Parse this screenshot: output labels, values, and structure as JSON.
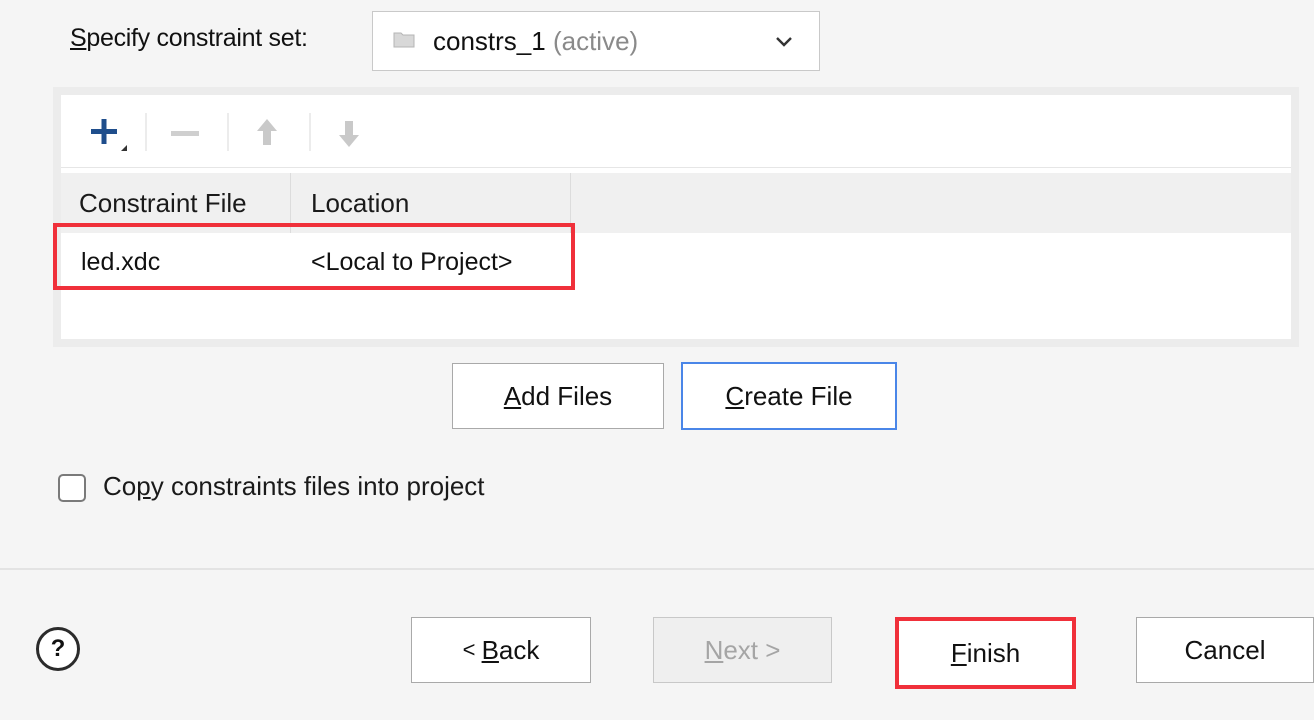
{
  "constraint_set": {
    "label": "Specify constraint set:",
    "label_mnemonic": "S",
    "label_rest": "pecify constraint set:",
    "value_name": "constrs_1",
    "value_status": "(active)"
  },
  "toolbar": {
    "add_icon": "plus-icon",
    "remove_icon": "minus-icon",
    "move_up_icon": "arrow-up-icon",
    "move_down_icon": "arrow-down-icon"
  },
  "table": {
    "columns": [
      "Constraint File",
      "Location"
    ],
    "rows": [
      [
        "led.xdc",
        "<Local to Project>"
      ]
    ]
  },
  "buttons": {
    "add_files_mnemonic": "A",
    "add_files_rest": "dd Files",
    "create_file_mnemonic": "C",
    "create_file_rest": "reate File"
  },
  "copy_option": {
    "before": "Co",
    "mnemonic": "p",
    "after": "y constraints files into project",
    "checked": false
  },
  "footer": {
    "help_glyph": "?",
    "back_prefix": "< ",
    "back_mnemonic": "B",
    "back_rest": "ack",
    "next_mnemonic": "N",
    "next_rest": "ext >",
    "finish_mnemonic": "F",
    "finish_rest": "inish",
    "cancel": "Cancel"
  },
  "colors": {
    "highlight": "#f0303a",
    "focus_border": "#4a86e8",
    "accent_icon": "#1f4e8c"
  }
}
